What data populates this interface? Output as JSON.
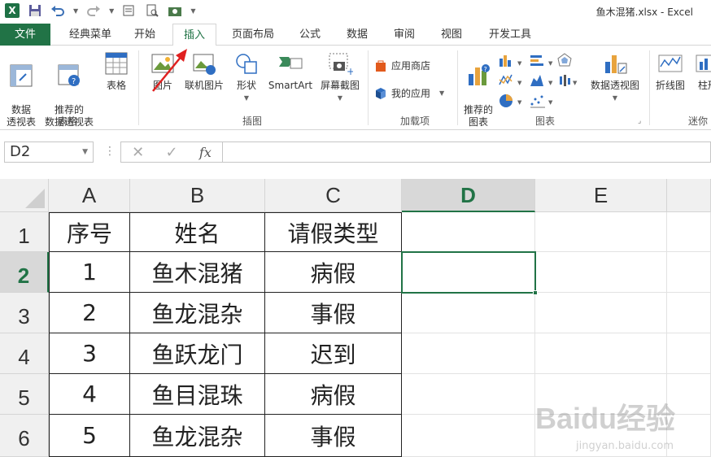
{
  "window": {
    "title": "鱼木混猪.xlsx - Excel"
  },
  "qat": {
    "logo": "X",
    "save_icon": "save-icon",
    "undo_icon": "undo-icon",
    "redo_icon": "redo-icon"
  },
  "ribbon_tabs": [
    "文件",
    "经典菜单",
    "开始",
    "插入",
    "页面布局",
    "公式",
    "数据",
    "审阅",
    "视图",
    "开发工具"
  ],
  "active_tab": "插入",
  "groups": {
    "tables": {
      "label": "表格",
      "pivot": "数据\n透视表",
      "recommended_pivot": "推荐的\n数据透视表",
      "table": "表格"
    },
    "illustrations": {
      "label": "插图",
      "pictures": "图片",
      "online_pictures": "联机图片",
      "shapes": "形状",
      "smartart": "SmartArt",
      "screenshot": "屏幕截图"
    },
    "addins": {
      "label": "加载项",
      "store": "应用商店",
      "my_apps": "我的应用"
    },
    "charts": {
      "label": "图表",
      "recommended": "推荐的\n图表",
      "pivot_chart": "数据透视图"
    },
    "sparklines": {
      "label": "迷你",
      "line": "折线图",
      "column": "柱形"
    }
  },
  "formula_bar": {
    "name_box": "D2",
    "formula": "",
    "fx": "fx"
  },
  "columns": [
    "A",
    "B",
    "C",
    "D",
    "E"
  ],
  "selected_column": "D",
  "rows": [
    "1",
    "2",
    "3",
    "4",
    "5",
    "6"
  ],
  "selected_row": "2",
  "table": {
    "headers": [
      "序号",
      "姓名",
      "请假类型"
    ],
    "rows": [
      [
        "1",
        "鱼木混猪",
        "病假"
      ],
      [
        "2",
        "鱼龙混杂",
        "事假"
      ],
      [
        "3",
        "鱼跃龙门",
        "迟到"
      ],
      [
        "4",
        "鱼目混珠",
        "病假"
      ],
      [
        "5",
        "鱼龙混杂",
        "事假"
      ]
    ]
  },
  "watermark": {
    "main": "Baidu经验",
    "sub": "jingyan.baidu.com"
  },
  "colors": {
    "excel_green": "#217346",
    "arrow_red": "#e02020"
  }
}
